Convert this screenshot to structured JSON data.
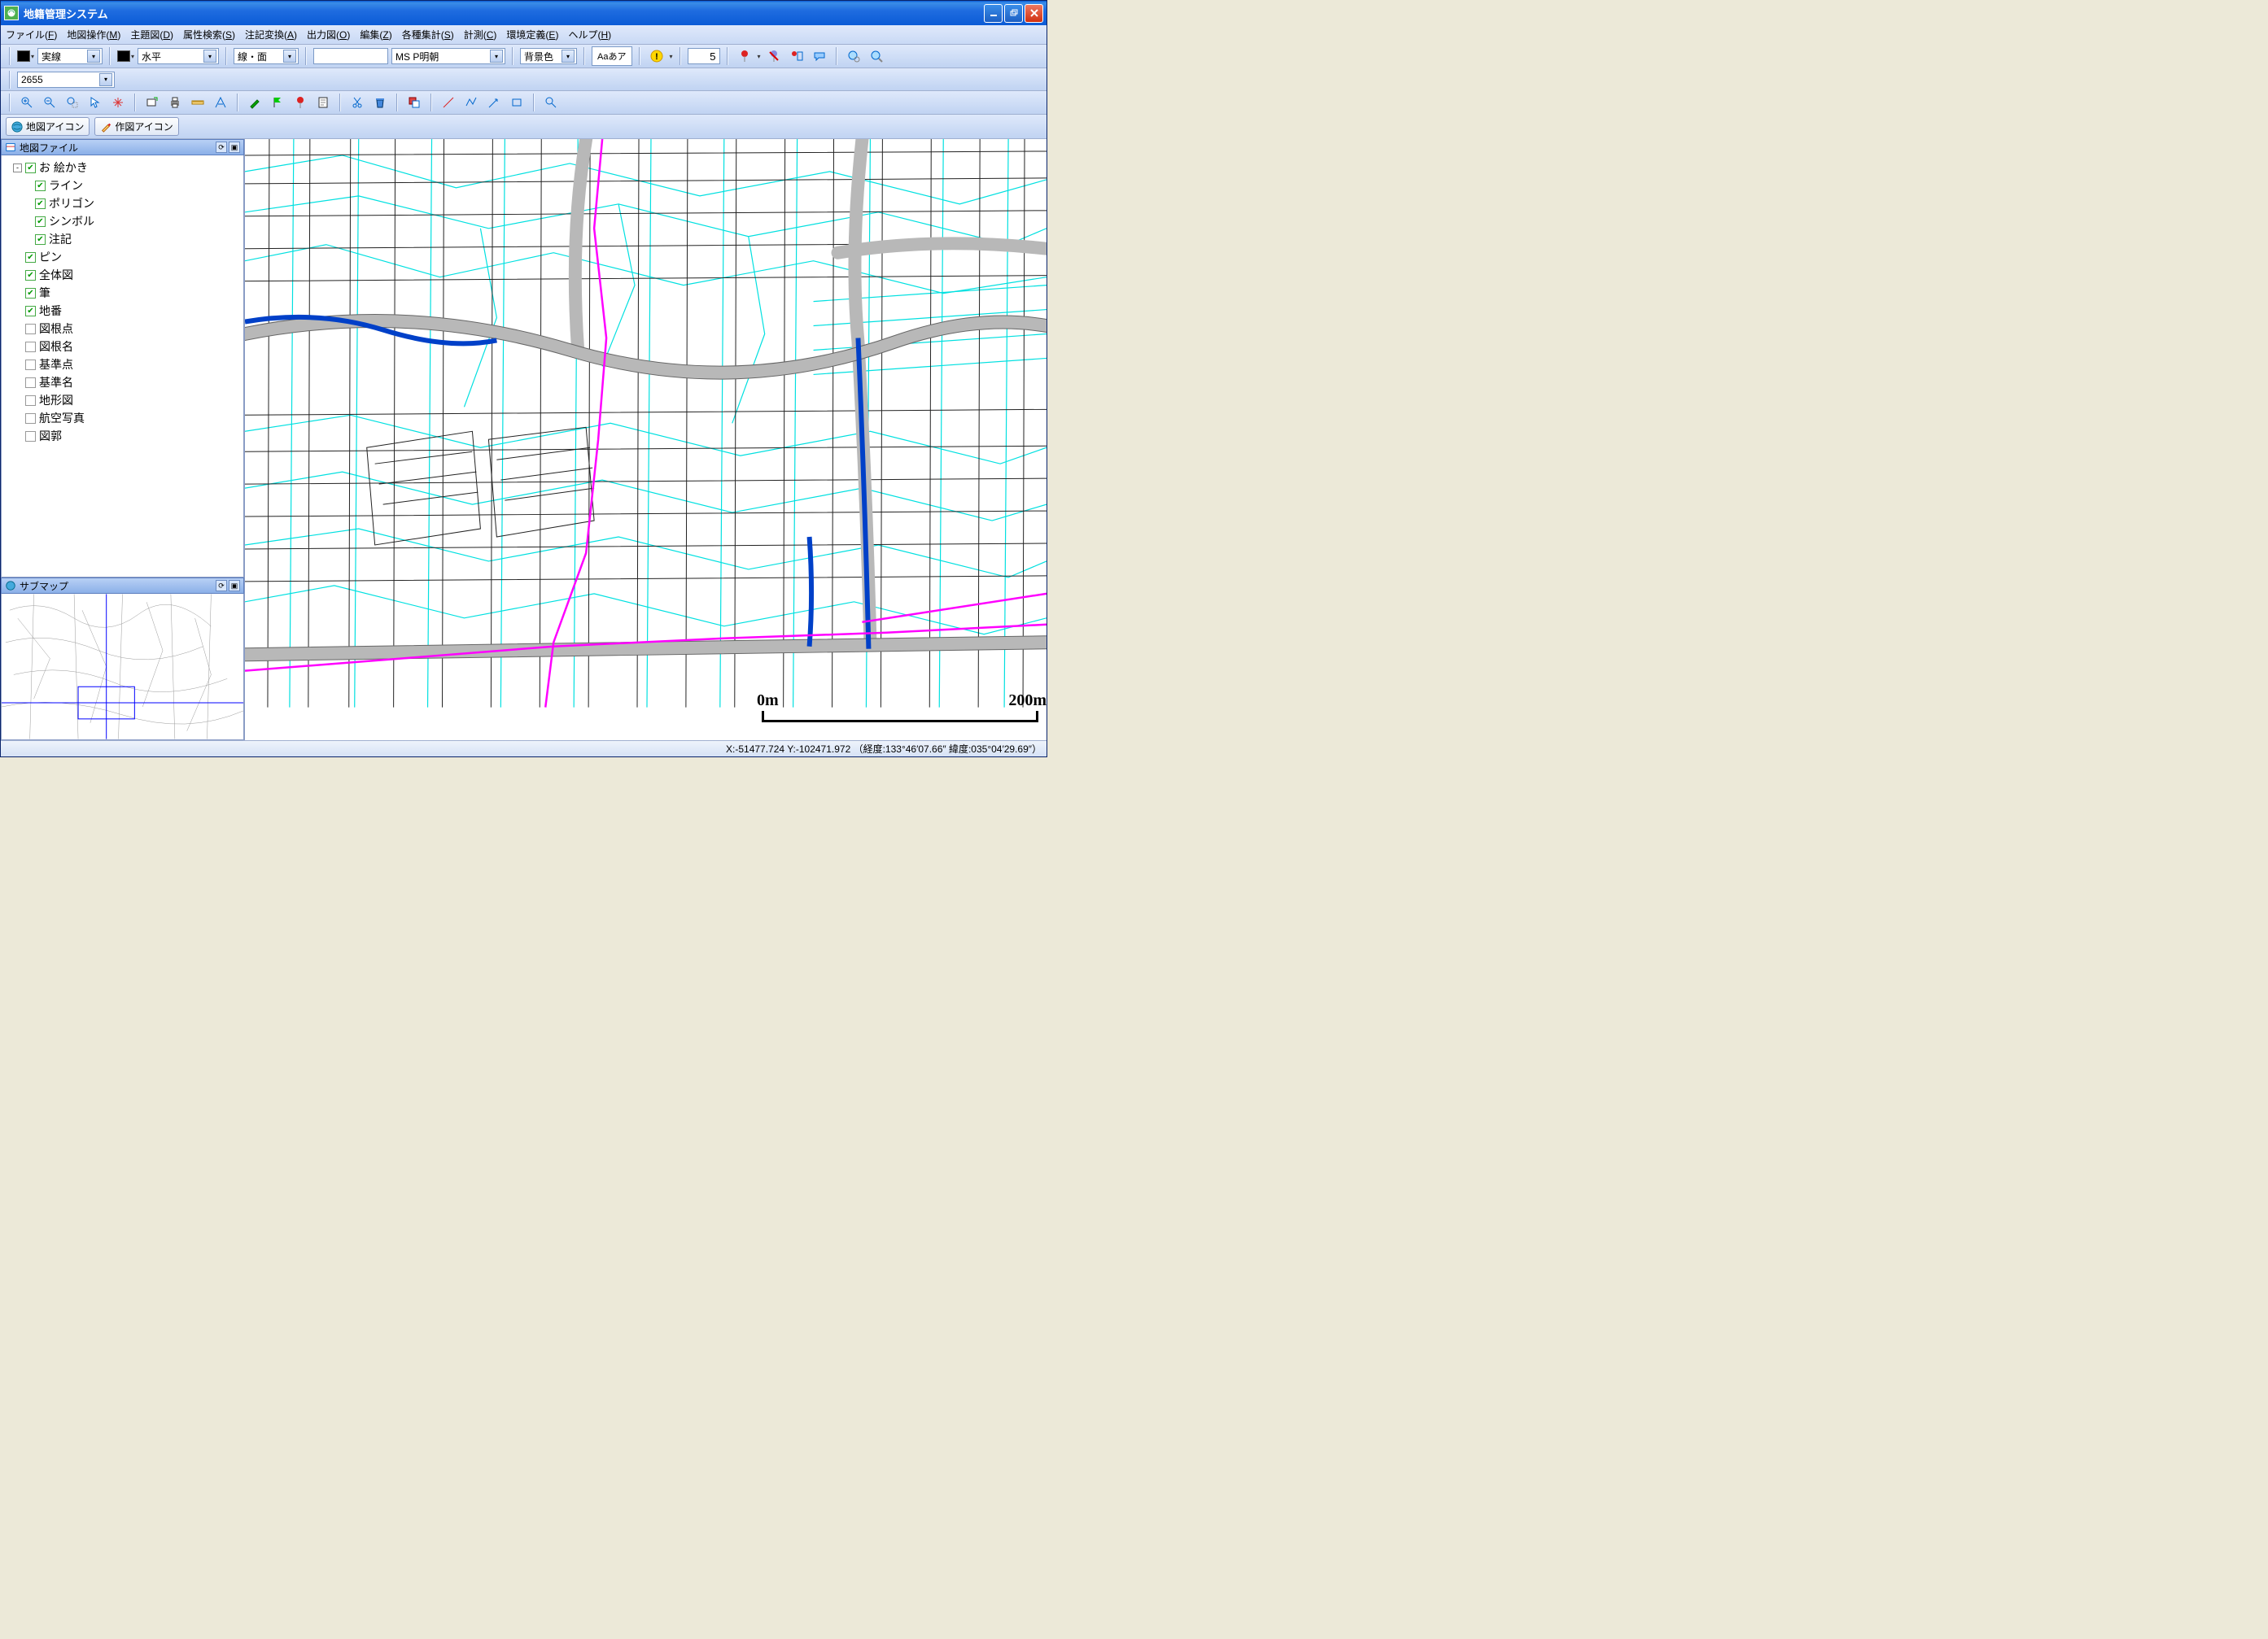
{
  "window": {
    "title": "地籍管理システム"
  },
  "menus": [
    {
      "label": "ファイル",
      "key": "F"
    },
    {
      "label": "地図操作",
      "key": "M"
    },
    {
      "label": "主題図",
      "key": "D"
    },
    {
      "label": "属性検索",
      "key": "S"
    },
    {
      "label": "注記変換",
      "key": "A"
    },
    {
      "label": "出力図",
      "key": "O"
    },
    {
      "label": "編集",
      "key": "Z"
    },
    {
      "label": "各種集計",
      "key": "S"
    },
    {
      "label": "計測",
      "key": "C"
    },
    {
      "label": "環境定義",
      "key": "E"
    },
    {
      "label": "ヘルプ",
      "key": "H"
    }
  ],
  "toolbar1": {
    "color1": "#000000",
    "lineStyle": "実線",
    "color2": "#000000",
    "hatch": "水平",
    "drawMode": "線・面",
    "textValue": "",
    "font": "MS P明朝",
    "bgMode": "背景色",
    "sample": "Aaあア",
    "sizeValue": "5"
  },
  "toolbar2": {
    "scale": "2655"
  },
  "modeTabs": {
    "map": "地図アイコン",
    "draw": "作図アイコン"
  },
  "panels": {
    "mapFiles": "地図ファイル",
    "subMap": "サブマップ"
  },
  "layers": [
    {
      "level": 0,
      "exp": "-",
      "checked": true,
      "label": "お 絵かき"
    },
    {
      "level": 1,
      "exp": "",
      "checked": true,
      "label": "ライン"
    },
    {
      "level": 1,
      "exp": "",
      "checked": true,
      "label": "ポリゴン"
    },
    {
      "level": 1,
      "exp": "",
      "checked": true,
      "label": "シンボル"
    },
    {
      "level": 1,
      "exp": "",
      "checked": true,
      "label": "注記"
    },
    {
      "level": 0,
      "exp": "",
      "checked": true,
      "label": "ピン"
    },
    {
      "level": 0,
      "exp": "",
      "checked": true,
      "label": "全体図"
    },
    {
      "level": 0,
      "exp": "",
      "checked": true,
      "label": "筆"
    },
    {
      "level": 0,
      "exp": "",
      "checked": true,
      "label": "地番"
    },
    {
      "level": 0,
      "exp": "",
      "checked": false,
      "label": "図根点"
    },
    {
      "level": 0,
      "exp": "",
      "checked": false,
      "label": "図根名"
    },
    {
      "level": 0,
      "exp": "",
      "checked": false,
      "label": "基準点"
    },
    {
      "level": 0,
      "exp": "",
      "checked": false,
      "label": "基準名"
    },
    {
      "level": 0,
      "exp": "",
      "checked": false,
      "label": "地形図"
    },
    {
      "level": 0,
      "exp": "",
      "checked": false,
      "label": "航空写真"
    },
    {
      "level": 0,
      "exp": "",
      "checked": false,
      "label": "図郭"
    }
  ],
  "scaleBar": {
    "zero": "0m",
    "end": "200m"
  },
  "status": {
    "coords": "X:-51477.724 Y:-102471.972 （経度:133°46′07.66″ 緯度:035°04′29.69″）"
  }
}
